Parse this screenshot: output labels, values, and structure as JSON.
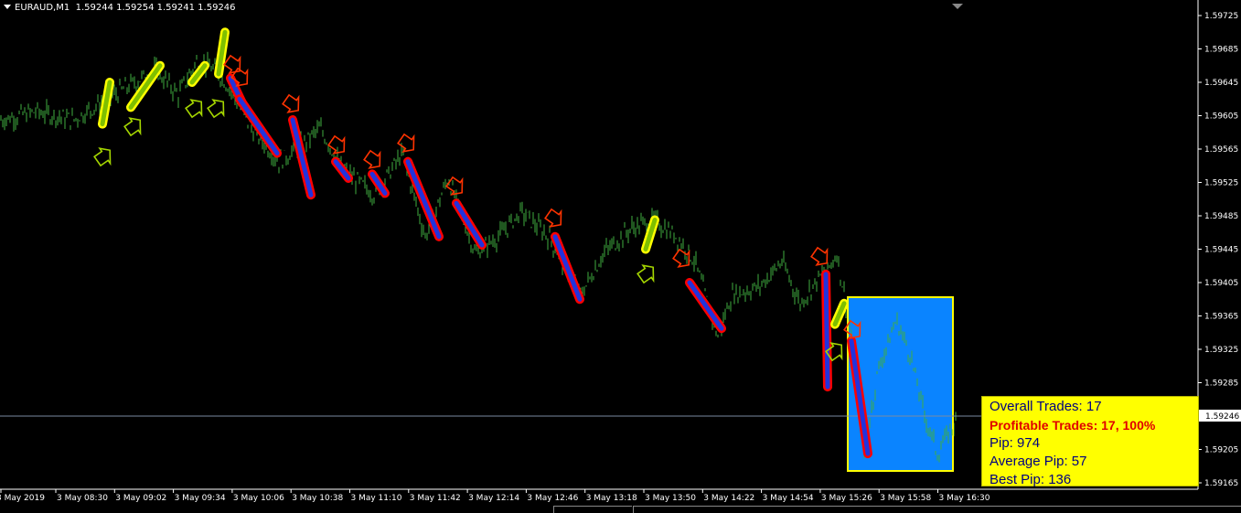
{
  "header": {
    "symbol_tf": "EURAUD,M1",
    "quotes": "1.59244 1.59254 1.59241 1.59246"
  },
  "current_price_label": "1.59246",
  "stats": {
    "overall": "Overall Trades: 17",
    "profitable": "Profitable Trades: 17, 100%",
    "pip": "Pip: 974",
    "average": "Average Pip: 57",
    "best": "Best Pip: 136"
  },
  "colors": {
    "background": "#000000",
    "candles": "#3fae3f",
    "sell_signal": "#ff3300",
    "buy_signal": "#a5d600",
    "sell_trade_fill": "#2233dd",
    "sell_trade_outline": "#ff0000",
    "buy_trade_fill": "#7fbf00",
    "buy_trade_outline": "#ffff00",
    "highlight_box": "#0a84ff",
    "highlight_border": "#ffff00",
    "stats_box": "#ffff00"
  },
  "chart_data": {
    "type": "candlestick",
    "symbol": "EURAUD",
    "timeframe": "M1",
    "ylim": [
      1.59148,
      1.59738
    ],
    "price_ticks": [
      "1.59725",
      "1.59685",
      "1.59645",
      "1.59605",
      "1.59565",
      "1.59525",
      "1.59485",
      "1.59445",
      "1.59405",
      "1.59365",
      "1.59325",
      "1.59285",
      "1.59205",
      "1.59165"
    ],
    "time_ticks": [
      "3 May 2019",
      "3 May 08:30",
      "3 May 09:02",
      "3 May 09:34",
      "3 May 10:06",
      "3 May 10:38",
      "3 May 11:10",
      "3 May 11:42",
      "3 May 12:14",
      "3 May 12:46",
      "3 May 13:18",
      "3 May 13:50",
      "3 May 14:22",
      "3 May 14:54",
      "3 May 15:26",
      "3 May 15:58",
      "3 May 16:30"
    ],
    "current_price": 1.59246,
    "price_path": [
      [
        0,
        1.596
      ],
      [
        40,
        1.5961
      ],
      [
        80,
        1.596
      ],
      [
        110,
        1.5962
      ],
      [
        140,
        1.5964
      ],
      [
        170,
        1.5966
      ],
      [
        195,
        1.5963
      ],
      [
        215,
        1.5967
      ],
      [
        235,
        1.5966
      ],
      [
        250,
        1.5964
      ],
      [
        275,
        1.5959
      ],
      [
        305,
        1.5955
      ],
      [
        330,
        1.5957
      ],
      [
        350,
        1.5959
      ],
      [
        375,
        1.5954
      ],
      [
        410,
        1.5951
      ],
      [
        440,
        1.5956
      ],
      [
        465,
        1.5946
      ],
      [
        490,
        1.5953
      ],
      [
        520,
        1.5944
      ],
      [
        545,
        1.5946
      ],
      [
        570,
        1.5949
      ],
      [
        600,
        1.5946
      ],
      [
        635,
        1.5939
      ],
      [
        660,
        1.5944
      ],
      [
        690,
        1.5947
      ],
      [
        715,
        1.5948
      ],
      [
        740,
        1.5946
      ],
      [
        760,
        1.5943
      ],
      [
        785,
        1.5934
      ],
      [
        800,
        1.5939
      ],
      [
        830,
        1.594
      ],
      [
        855,
        1.5943
      ],
      [
        875,
        1.5938
      ],
      [
        895,
        1.5941
      ],
      [
        905,
        1.5942
      ],
      [
        915,
        1.5944
      ],
      [
        930,
        1.5935
      ],
      [
        945,
        1.592
      ],
      [
        960,
        1.593
      ],
      [
        980,
        1.5936
      ],
      [
        995,
        1.5932
      ],
      [
        1010,
        1.5925
      ],
      [
        1025,
        1.592
      ],
      [
        1045,
        1.5924
      ]
    ],
    "sell_trades": [
      {
        "entry": 1.5965,
        "exit": 1.5962
      },
      {
        "entry": 1.59625,
        "exit": 1.5956
      },
      {
        "entry": 1.596,
        "exit": 1.5951
      },
      {
        "entry": 1.5955,
        "exit": 1.5953
      },
      {
        "entry": 1.59535,
        "exit": 1.59512
      },
      {
        "entry": 1.5955,
        "exit": 1.5946
      },
      {
        "entry": 1.595,
        "exit": 1.5945
      },
      {
        "entry": 1.5946,
        "exit": 1.59385
      },
      {
        "entry": 1.59405,
        "exit": 1.5935
      },
      {
        "entry": 1.59415,
        "exit": 1.5928
      },
      {
        "entry": 1.59335,
        "exit": 1.592
      }
    ],
    "buy_trades": [
      {
        "entry": 1.59595,
        "exit": 1.59645
      },
      {
        "entry": 1.59615,
        "exit": 1.59665
      },
      {
        "entry": 1.59645,
        "exit": 1.59665
      },
      {
        "entry": 1.59655,
        "exit": 1.59705
      },
      {
        "entry": 1.59445,
        "exit": 1.5948
      },
      {
        "entry": 1.59355,
        "exit": 1.5938
      }
    ]
  }
}
